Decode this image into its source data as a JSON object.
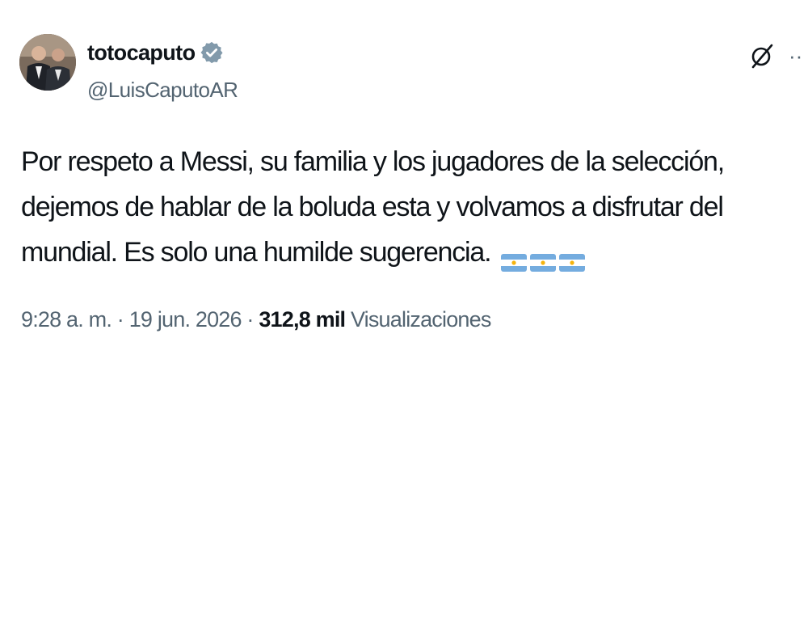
{
  "author": {
    "display_name": "totocaputo",
    "handle": "@LuisCaputoAR",
    "verified_icon": "verified-badge-icon",
    "avatar_icon": "avatar"
  },
  "actions": {
    "grok_icon": "grok-icon",
    "more_icon": "more-icon",
    "more_label": "··"
  },
  "tweet": {
    "text": "Por respeto a Messi, su familia y los jugadores de la selección, dejemos de hablar de la boluda esta y volvamos a disfrutar del mundial. Es solo una humilde sugerencia.",
    "emoji": [
      "argentina-flag-icon",
      "argentina-flag-icon",
      "argentina-flag-icon"
    ]
  },
  "meta": {
    "time": "9:28 a. m.",
    "separator": " · ",
    "date": "19 jun. 2026",
    "views_count": "312,8 mil",
    "views_label": "Visualizaciones"
  },
  "colors": {
    "text_primary": "#0f1419",
    "text_secondary": "#536471",
    "flag_blue": "#74acdf",
    "flag_sun": "#f6b40e"
  }
}
